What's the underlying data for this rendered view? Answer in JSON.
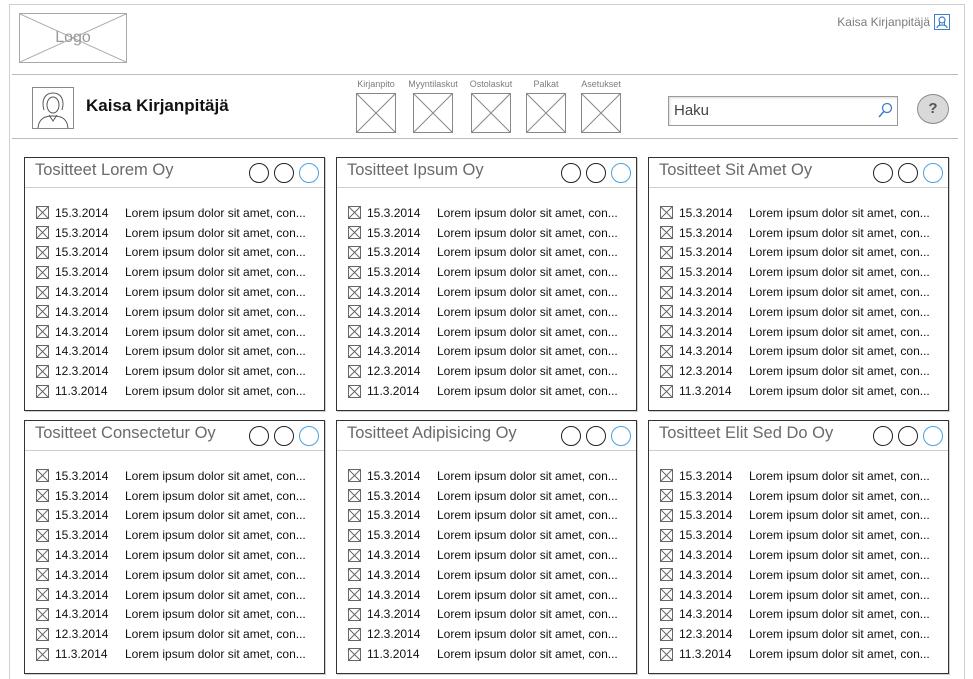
{
  "header": {
    "logo_text": "Logo",
    "top_user": "Kaisa Kirjanpitäjä",
    "user_name": "Kaisa Kirjanpitäjä",
    "user_icon": "user-icon",
    "avatar_icon": "user-avatar"
  },
  "nav": [
    {
      "label": "Kirjanpito"
    },
    {
      "label": "Myyntilaskut"
    },
    {
      "label": "Ostolaskut"
    },
    {
      "label": "Palkat"
    },
    {
      "label": "Asetukset"
    }
  ],
  "search": {
    "placeholder": "Haku",
    "icon": "search-icon"
  },
  "help": {
    "label": "?"
  },
  "colors": {
    "accent": "#4aa3df",
    "border": "#333333",
    "muted": "#6a6a6a"
  },
  "panels": [
    {
      "title": "Tositteet Lorem Oy",
      "rows": [
        {
          "date": "15.3.2014",
          "text": "Lorem ipsum dolor sit amet, con..."
        },
        {
          "date": "15.3.2014",
          "text": "Lorem ipsum dolor sit amet, con..."
        },
        {
          "date": "15.3.2014",
          "text": "Lorem ipsum dolor sit amet, con..."
        },
        {
          "date": "15.3.2014",
          "text": "Lorem ipsum dolor sit amet, con..."
        },
        {
          "date": "14.3.2014",
          "text": "Lorem ipsum dolor sit amet, con..."
        },
        {
          "date": "14.3.2014",
          "text": "Lorem ipsum dolor sit amet, con..."
        },
        {
          "date": "14.3.2014",
          "text": "Lorem ipsum dolor sit amet, con..."
        },
        {
          "date": "14.3.2014",
          "text": "Lorem ipsum dolor sit amet, con..."
        },
        {
          "date": "12.3.2014",
          "text": "Lorem ipsum dolor sit amet, con..."
        },
        {
          "date": "11.3.2014",
          "text": "Lorem ipsum dolor sit amet, con..."
        }
      ]
    },
    {
      "title": "Tositteet Ipsum Oy",
      "rows": [
        {
          "date": "15.3.2014",
          "text": "Lorem ipsum dolor sit amet, con..."
        },
        {
          "date": "15.3.2014",
          "text": "Lorem ipsum dolor sit amet, con..."
        },
        {
          "date": "15.3.2014",
          "text": "Lorem ipsum dolor sit amet, con..."
        },
        {
          "date": "15.3.2014",
          "text": "Lorem ipsum dolor sit amet, con..."
        },
        {
          "date": "14.3.2014",
          "text": "Lorem ipsum dolor sit amet, con..."
        },
        {
          "date": "14.3.2014",
          "text": "Lorem ipsum dolor sit amet, con..."
        },
        {
          "date": "14.3.2014",
          "text": "Lorem ipsum dolor sit amet, con..."
        },
        {
          "date": "14.3.2014",
          "text": "Lorem ipsum dolor sit amet, con..."
        },
        {
          "date": "12.3.2014",
          "text": "Lorem ipsum dolor sit amet, con..."
        },
        {
          "date": "11.3.2014",
          "text": "Lorem ipsum dolor sit amet, con..."
        }
      ]
    },
    {
      "title": "Tositteet Sit Amet Oy",
      "rows": [
        {
          "date": "15.3.2014",
          "text": "Lorem ipsum dolor sit amet, con..."
        },
        {
          "date": "15.3.2014",
          "text": "Lorem ipsum dolor sit amet, con..."
        },
        {
          "date": "15.3.2014",
          "text": "Lorem ipsum dolor sit amet, con..."
        },
        {
          "date": "15.3.2014",
          "text": "Lorem ipsum dolor sit amet, con..."
        },
        {
          "date": "14.3.2014",
          "text": "Lorem ipsum dolor sit amet, con..."
        },
        {
          "date": "14.3.2014",
          "text": "Lorem ipsum dolor sit amet, con..."
        },
        {
          "date": "14.3.2014",
          "text": "Lorem ipsum dolor sit amet, con..."
        },
        {
          "date": "14.3.2014",
          "text": "Lorem ipsum dolor sit amet, con..."
        },
        {
          "date": "12.3.2014",
          "text": "Lorem ipsum dolor sit amet, con..."
        },
        {
          "date": "11.3.2014",
          "text": "Lorem ipsum dolor sit amet, con..."
        }
      ]
    },
    {
      "title": "Tositteet Consectetur Oy",
      "rows": [
        {
          "date": "15.3.2014",
          "text": "Lorem ipsum dolor sit amet, con..."
        },
        {
          "date": "15.3.2014",
          "text": "Lorem ipsum dolor sit amet, con..."
        },
        {
          "date": "15.3.2014",
          "text": "Lorem ipsum dolor sit amet, con..."
        },
        {
          "date": "15.3.2014",
          "text": "Lorem ipsum dolor sit amet, con..."
        },
        {
          "date": "14.3.2014",
          "text": "Lorem ipsum dolor sit amet, con..."
        },
        {
          "date": "14.3.2014",
          "text": "Lorem ipsum dolor sit amet, con..."
        },
        {
          "date": "14.3.2014",
          "text": "Lorem ipsum dolor sit amet, con..."
        },
        {
          "date": "14.3.2014",
          "text": "Lorem ipsum dolor sit amet, con..."
        },
        {
          "date": "12.3.2014",
          "text": "Lorem ipsum dolor sit amet, con..."
        },
        {
          "date": "11.3.2014",
          "text": "Lorem ipsum dolor sit amet, con..."
        }
      ]
    },
    {
      "title": "Tositteet Adipisicing Oy",
      "rows": [
        {
          "date": "15.3.2014",
          "text": "Lorem ipsum dolor sit amet, con..."
        },
        {
          "date": "15.3.2014",
          "text": "Lorem ipsum dolor sit amet, con..."
        },
        {
          "date": "15.3.2014",
          "text": "Lorem ipsum dolor sit amet, con..."
        },
        {
          "date": "15.3.2014",
          "text": "Lorem ipsum dolor sit amet, con..."
        },
        {
          "date": "14.3.2014",
          "text": "Lorem ipsum dolor sit amet, con..."
        },
        {
          "date": "14.3.2014",
          "text": "Lorem ipsum dolor sit amet, con..."
        },
        {
          "date": "14.3.2014",
          "text": "Lorem ipsum dolor sit amet, con..."
        },
        {
          "date": "14.3.2014",
          "text": "Lorem ipsum dolor sit amet, con..."
        },
        {
          "date": "12.3.2014",
          "text": "Lorem ipsum dolor sit amet, con..."
        },
        {
          "date": "11.3.2014",
          "text": "Lorem ipsum dolor sit amet, con..."
        }
      ]
    },
    {
      "title": "Tositteet Elit Sed Do Oy",
      "rows": [
        {
          "date": "15.3.2014",
          "text": "Lorem ipsum dolor sit amet, con..."
        },
        {
          "date": "15.3.2014",
          "text": "Lorem ipsum dolor sit amet, con..."
        },
        {
          "date": "15.3.2014",
          "text": "Lorem ipsum dolor sit amet, con..."
        },
        {
          "date": "15.3.2014",
          "text": "Lorem ipsum dolor sit amet, con..."
        },
        {
          "date": "14.3.2014",
          "text": "Lorem ipsum dolor sit amet, con..."
        },
        {
          "date": "14.3.2014",
          "text": "Lorem ipsum dolor sit amet, con..."
        },
        {
          "date": "14.3.2014",
          "text": "Lorem ipsum dolor sit amet, con..."
        },
        {
          "date": "14.3.2014",
          "text": "Lorem ipsum dolor sit amet, con..."
        },
        {
          "date": "12.3.2014",
          "text": "Lorem ipsum dolor sit amet, con..."
        },
        {
          "date": "11.3.2014",
          "text": "Lorem ipsum dolor sit amet, con..."
        }
      ]
    }
  ]
}
